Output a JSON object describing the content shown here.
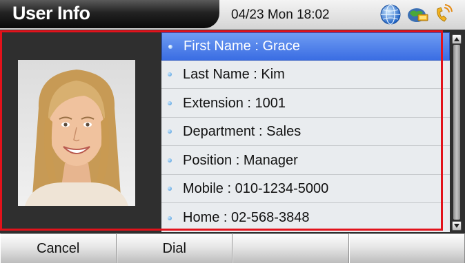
{
  "header": {
    "title": "User Info",
    "datetime": "04/23 Mon 18:02",
    "status_icons": [
      "globe-icon",
      "network-icon",
      "phone-ring-icon"
    ]
  },
  "contact": {
    "photo": "contact-photo",
    "fields": [
      {
        "label": "First Name : Grace",
        "selected": true
      },
      {
        "label": "Last Name : Kim",
        "selected": false
      },
      {
        "label": "Extension : 1001",
        "selected": false
      },
      {
        "label": "Department : Sales",
        "selected": false
      },
      {
        "label": "Position : Manager",
        "selected": false
      },
      {
        "label": "Mobile : 010-1234-5000",
        "selected": false
      },
      {
        "label": "Home : 02-568-3848",
        "selected": false
      }
    ]
  },
  "softkeys": [
    {
      "label": "Cancel"
    },
    {
      "label": "Dial"
    },
    {
      "label": ""
    },
    {
      "label": ""
    }
  ],
  "colors": {
    "selection": "#4a7be8",
    "highlight_frame": "#e2121b",
    "panel": "#2f2f2f"
  }
}
